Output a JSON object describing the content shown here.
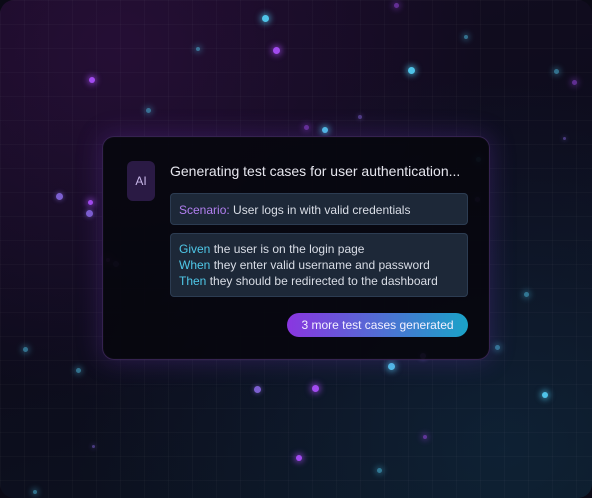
{
  "card": {
    "avatar_label": "AI",
    "title": "Generating test cases for user authentication...",
    "scenario": {
      "keyword": "Scenario",
      "separator": ":",
      "text": " User logs in with valid credentials"
    },
    "steps": [
      {
        "keyword": "Given",
        "text": " the user is on the login page"
      },
      {
        "keyword": "When",
        "text": " they enter valid username and password"
      },
      {
        "keyword": "Then",
        "text": " they should be redirected to the dashboard"
      }
    ],
    "more_label": "3 more test cases generated"
  },
  "colors": {
    "accent_purple": "#a24bf0",
    "accent_cyan": "#4fc3e8",
    "card_background": "#06060e",
    "box_background": "#1d2838"
  }
}
